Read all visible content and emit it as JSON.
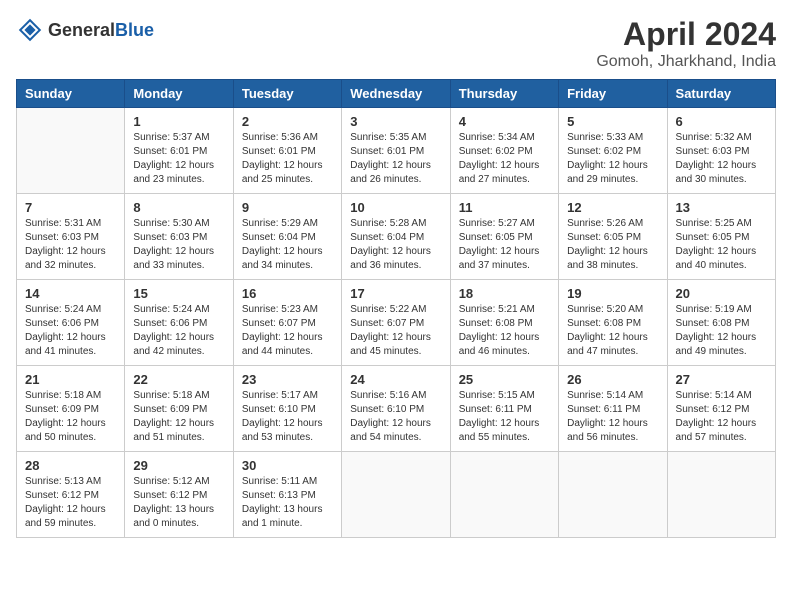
{
  "header": {
    "logo_general": "General",
    "logo_blue": "Blue",
    "main_title": "April 2024",
    "subtitle": "Gomoh, Jharkhand, India"
  },
  "weekdays": [
    "Sunday",
    "Monday",
    "Tuesday",
    "Wednesday",
    "Thursday",
    "Friday",
    "Saturday"
  ],
  "weeks": [
    [
      {
        "day": "",
        "empty": true
      },
      {
        "day": "1",
        "sunrise": "Sunrise: 5:37 AM",
        "sunset": "Sunset: 6:01 PM",
        "daylight": "Daylight: 12 hours and 23 minutes."
      },
      {
        "day": "2",
        "sunrise": "Sunrise: 5:36 AM",
        "sunset": "Sunset: 6:01 PM",
        "daylight": "Daylight: 12 hours and 25 minutes."
      },
      {
        "day": "3",
        "sunrise": "Sunrise: 5:35 AM",
        "sunset": "Sunset: 6:01 PM",
        "daylight": "Daylight: 12 hours and 26 minutes."
      },
      {
        "day": "4",
        "sunrise": "Sunrise: 5:34 AM",
        "sunset": "Sunset: 6:02 PM",
        "daylight": "Daylight: 12 hours and 27 minutes."
      },
      {
        "day": "5",
        "sunrise": "Sunrise: 5:33 AM",
        "sunset": "Sunset: 6:02 PM",
        "daylight": "Daylight: 12 hours and 29 minutes."
      },
      {
        "day": "6",
        "sunrise": "Sunrise: 5:32 AM",
        "sunset": "Sunset: 6:03 PM",
        "daylight": "Daylight: 12 hours and 30 minutes."
      }
    ],
    [
      {
        "day": "7",
        "sunrise": "Sunrise: 5:31 AM",
        "sunset": "Sunset: 6:03 PM",
        "daylight": "Daylight: 12 hours and 32 minutes."
      },
      {
        "day": "8",
        "sunrise": "Sunrise: 5:30 AM",
        "sunset": "Sunset: 6:03 PM",
        "daylight": "Daylight: 12 hours and 33 minutes."
      },
      {
        "day": "9",
        "sunrise": "Sunrise: 5:29 AM",
        "sunset": "Sunset: 6:04 PM",
        "daylight": "Daylight: 12 hours and 34 minutes."
      },
      {
        "day": "10",
        "sunrise": "Sunrise: 5:28 AM",
        "sunset": "Sunset: 6:04 PM",
        "daylight": "Daylight: 12 hours and 36 minutes."
      },
      {
        "day": "11",
        "sunrise": "Sunrise: 5:27 AM",
        "sunset": "Sunset: 6:05 PM",
        "daylight": "Daylight: 12 hours and 37 minutes."
      },
      {
        "day": "12",
        "sunrise": "Sunrise: 5:26 AM",
        "sunset": "Sunset: 6:05 PM",
        "daylight": "Daylight: 12 hours and 38 minutes."
      },
      {
        "day": "13",
        "sunrise": "Sunrise: 5:25 AM",
        "sunset": "Sunset: 6:05 PM",
        "daylight": "Daylight: 12 hours and 40 minutes."
      }
    ],
    [
      {
        "day": "14",
        "sunrise": "Sunrise: 5:24 AM",
        "sunset": "Sunset: 6:06 PM",
        "daylight": "Daylight: 12 hours and 41 minutes."
      },
      {
        "day": "15",
        "sunrise": "Sunrise: 5:24 AM",
        "sunset": "Sunset: 6:06 PM",
        "daylight": "Daylight: 12 hours and 42 minutes."
      },
      {
        "day": "16",
        "sunrise": "Sunrise: 5:23 AM",
        "sunset": "Sunset: 6:07 PM",
        "daylight": "Daylight: 12 hours and 44 minutes."
      },
      {
        "day": "17",
        "sunrise": "Sunrise: 5:22 AM",
        "sunset": "Sunset: 6:07 PM",
        "daylight": "Daylight: 12 hours and 45 minutes."
      },
      {
        "day": "18",
        "sunrise": "Sunrise: 5:21 AM",
        "sunset": "Sunset: 6:08 PM",
        "daylight": "Daylight: 12 hours and 46 minutes."
      },
      {
        "day": "19",
        "sunrise": "Sunrise: 5:20 AM",
        "sunset": "Sunset: 6:08 PM",
        "daylight": "Daylight: 12 hours and 47 minutes."
      },
      {
        "day": "20",
        "sunrise": "Sunrise: 5:19 AM",
        "sunset": "Sunset: 6:08 PM",
        "daylight": "Daylight: 12 hours and 49 minutes."
      }
    ],
    [
      {
        "day": "21",
        "sunrise": "Sunrise: 5:18 AM",
        "sunset": "Sunset: 6:09 PM",
        "daylight": "Daylight: 12 hours and 50 minutes."
      },
      {
        "day": "22",
        "sunrise": "Sunrise: 5:18 AM",
        "sunset": "Sunset: 6:09 PM",
        "daylight": "Daylight: 12 hours and 51 minutes."
      },
      {
        "day": "23",
        "sunrise": "Sunrise: 5:17 AM",
        "sunset": "Sunset: 6:10 PM",
        "daylight": "Daylight: 12 hours and 53 minutes."
      },
      {
        "day": "24",
        "sunrise": "Sunrise: 5:16 AM",
        "sunset": "Sunset: 6:10 PM",
        "daylight": "Daylight: 12 hours and 54 minutes."
      },
      {
        "day": "25",
        "sunrise": "Sunrise: 5:15 AM",
        "sunset": "Sunset: 6:11 PM",
        "daylight": "Daylight: 12 hours and 55 minutes."
      },
      {
        "day": "26",
        "sunrise": "Sunrise: 5:14 AM",
        "sunset": "Sunset: 6:11 PM",
        "daylight": "Daylight: 12 hours and 56 minutes."
      },
      {
        "day": "27",
        "sunrise": "Sunrise: 5:14 AM",
        "sunset": "Sunset: 6:12 PM",
        "daylight": "Daylight: 12 hours and 57 minutes."
      }
    ],
    [
      {
        "day": "28",
        "sunrise": "Sunrise: 5:13 AM",
        "sunset": "Sunset: 6:12 PM",
        "daylight": "Daylight: 12 hours and 59 minutes."
      },
      {
        "day": "29",
        "sunrise": "Sunrise: 5:12 AM",
        "sunset": "Sunset: 6:12 PM",
        "daylight": "Daylight: 13 hours and 0 minutes."
      },
      {
        "day": "30",
        "sunrise": "Sunrise: 5:11 AM",
        "sunset": "Sunset: 6:13 PM",
        "daylight": "Daylight: 13 hours and 1 minute."
      },
      {
        "day": "",
        "empty": true
      },
      {
        "day": "",
        "empty": true
      },
      {
        "day": "",
        "empty": true
      },
      {
        "day": "",
        "empty": true
      }
    ]
  ]
}
